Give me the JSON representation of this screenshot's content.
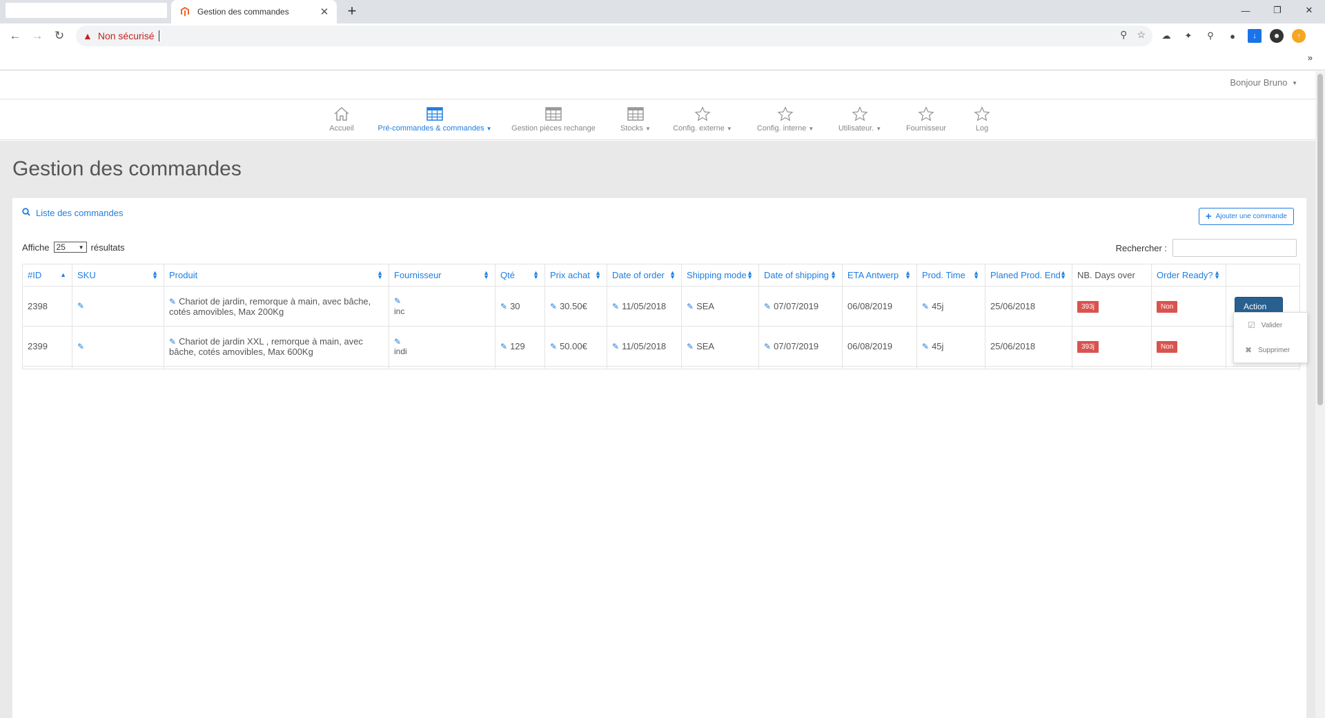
{
  "browser": {
    "tab_title": "Gestion des commandes",
    "tab_close": "✕",
    "new_tab": "+",
    "security_label": "Non sécurisé",
    "bookmarks_chevron": "»"
  },
  "header": {
    "greeting": "Bonjour Bruno"
  },
  "nav": {
    "items": [
      {
        "label": "Accueil",
        "icon": "home-icon",
        "dropdown": false,
        "active": false
      },
      {
        "label": "Pré-commandes & commandes",
        "icon": "table-icon",
        "dropdown": true,
        "active": true
      },
      {
        "label": "Gestion pièces rechange",
        "icon": "table-icon",
        "dropdown": false,
        "active": false
      },
      {
        "label": "Stocks",
        "icon": "table-icon",
        "dropdown": true,
        "active": false
      },
      {
        "label": "Config. externe",
        "icon": "star-icon",
        "dropdown": true,
        "active": false
      },
      {
        "label": "Config. interne",
        "icon": "star-icon",
        "dropdown": true,
        "active": false
      },
      {
        "label": "Utilisateur.",
        "icon": "star-icon",
        "dropdown": true,
        "active": false
      },
      {
        "label": "Fournisseur",
        "icon": "star-icon",
        "dropdown": false,
        "active": false
      },
      {
        "label": "Log",
        "icon": "star-icon",
        "dropdown": false,
        "active": false
      }
    ],
    "accent_color": "#1f7ee0"
  },
  "page": {
    "title": "Gestion des commandes",
    "list_heading": "Liste des commandes",
    "add_button": "Ajouter une commande",
    "length_prefix": "Affiche",
    "length_value": "25",
    "length_suffix": "résultats",
    "search_label": "Rechercher :"
  },
  "table": {
    "columns": [
      "#ID",
      "SKU",
      "Produit",
      "Fournisseur",
      "Qté",
      "Prix achat",
      "Date of order",
      "Shipping mode",
      "Date of shipping",
      "ETA Antwerp",
      "Prod. Time",
      "Planed Prod. End",
      "NB. Days over",
      "Order Ready?",
      ""
    ],
    "rows": [
      {
        "id": "2398",
        "product": "Chariot de jardin, remorque à main, avec bâche, cotés amovibles, Max 200Kg",
        "supplier_partial": "inc",
        "qty": "30",
        "price": "30.50€",
        "date_order": "11/05/2018",
        "shipping_mode": "SEA",
        "date_shipping": "07/07/2019",
        "eta": "06/08/2019",
        "prod_time": "45j",
        "prod_end": "25/06/2018",
        "days_over": "393j",
        "ready": "Non",
        "action": "Action"
      },
      {
        "id": "2399",
        "product": "Chariot de jardin XXL , remorque à main, avec bâche, cotés amovibles, Max 600Kg",
        "supplier_partial": "indi",
        "qty": "129",
        "price": "50.00€",
        "date_order": "11/05/2018",
        "shipping_mode": "SEA",
        "date_shipping": "07/07/2019",
        "eta": "06/08/2019",
        "prod_time": "45j",
        "prod_end": "25/06/2018",
        "days_over": "393j",
        "ready": "Non"
      }
    ]
  },
  "action_menu": {
    "validate": "Valider",
    "delete": "Supprimer"
  },
  "colors": {
    "danger": "#d9534f",
    "primary_button": "#286090",
    "link": "#1f7ee0"
  }
}
